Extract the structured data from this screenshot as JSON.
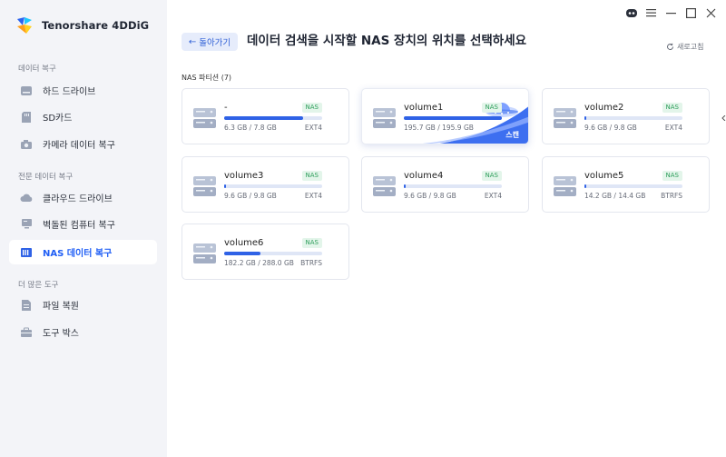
{
  "app": {
    "name": "Tenorshare 4DDiG"
  },
  "sidebar": {
    "sections": [
      {
        "title": "데이터 복구",
        "items": [
          {
            "label": "하드 드라이브",
            "icon": "hard-drive-icon"
          },
          {
            "label": "SD카드",
            "icon": "sd-card-icon"
          },
          {
            "label": "카메라 데이터 복구",
            "icon": "camera-icon"
          }
        ]
      },
      {
        "title": "전문 데이터 복구",
        "items": [
          {
            "label": "클라우드 드라이브",
            "icon": "cloud-icon"
          },
          {
            "label": "벽돌된 컴퓨터 복구",
            "icon": "computer-icon"
          },
          {
            "label": "NAS 데이터 복구",
            "icon": "nas-icon",
            "active": true
          }
        ]
      },
      {
        "title": "더 많은 도구",
        "items": [
          {
            "label": "파일 복원",
            "icon": "file-repair-icon"
          },
          {
            "label": "도구 박스",
            "icon": "toolbox-icon"
          }
        ]
      }
    ]
  },
  "header": {
    "back_label": "돌아가기",
    "title": "데이터 검색을 시작할 NAS 장치의 위치를 선택하세요",
    "refresh_label": "새로고침"
  },
  "partitions": {
    "label": "NAS 파티션 (7)",
    "items": [
      {
        "name": "-",
        "badge": "NAS",
        "size": "6.3 GB / 7.8 GB",
        "fs": "EXT4",
        "used_fraction": 0.81
      },
      {
        "name": "volume1",
        "badge": "NAS",
        "size": "195.7 GB / 195.9 GB",
        "fs": "EXT4",
        "used_fraction": 0.999,
        "selected": true,
        "action": "스캔"
      },
      {
        "name": "volume2",
        "badge": "NAS",
        "size": "9.6 GB / 9.8 GB",
        "fs": "EXT4",
        "used_fraction": 0.02
      },
      {
        "name": "volume3",
        "badge": "NAS",
        "size": "9.6 GB / 9.8 GB",
        "fs": "EXT4",
        "used_fraction": 0.02
      },
      {
        "name": "volume4",
        "badge": "NAS",
        "size": "9.6 GB / 9.8 GB",
        "fs": "EXT4",
        "used_fraction": 0.02
      },
      {
        "name": "volume5",
        "badge": "NAS",
        "size": "14.2 GB / 14.4 GB",
        "fs": "BTRFS",
        "used_fraction": 0.02
      },
      {
        "name": "volume6",
        "badge": "NAS",
        "size": "182.2 GB / 288.0 GB",
        "fs": "BTRFS",
        "used_fraction": 0.37
      }
    ]
  },
  "colors": {
    "accent": "#2f62e6",
    "sidebar_bg": "#f3f4f8",
    "badge_green": "#2e9e5b"
  }
}
